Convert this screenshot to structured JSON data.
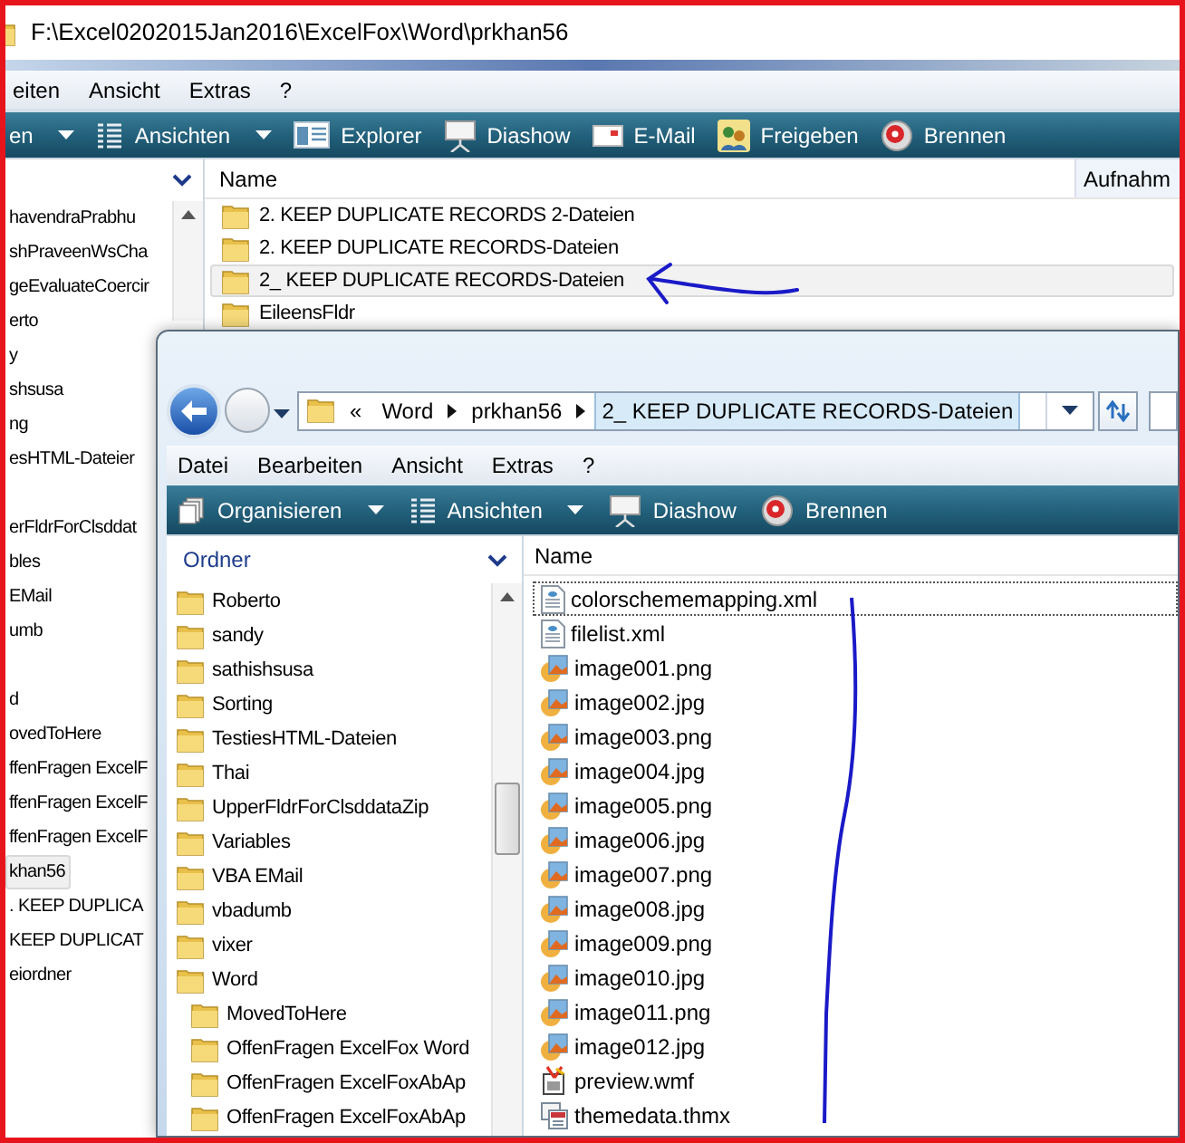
{
  "back_window": {
    "title": "F:\\Excel0202015Jan2016\\ExcelFox\\Word\\prkhan56",
    "menu": [
      "eiten",
      "Ansicht",
      "Extras",
      "?"
    ],
    "toolbar": [
      {
        "label": "en",
        "kind": "plain",
        "has_menu": true
      },
      {
        "label": "Ansichten",
        "kind": "views",
        "has_menu": true
      },
      {
        "label": "Explorer",
        "kind": "explorer",
        "has_menu": false
      },
      {
        "label": "Diashow",
        "kind": "slideshow",
        "has_menu": false
      },
      {
        "label": "E-Mail",
        "kind": "email",
        "has_menu": false
      },
      {
        "label": "Freigeben",
        "kind": "share",
        "has_menu": false
      },
      {
        "label": "Brennen",
        "kind": "burn",
        "has_menu": false
      }
    ],
    "folder_tree": [
      {
        "kind": "folder",
        "label": "havendraPrabhu",
        "selected": false
      },
      {
        "kind": "folder",
        "label": "shPraveenWsCha",
        "selected": false
      },
      {
        "kind": "folder",
        "label": "geEvaluateCoercir",
        "selected": false
      },
      {
        "kind": "folder",
        "label": "erto",
        "selected": false
      },
      {
        "kind": "folder",
        "label": "y",
        "selected": false
      },
      {
        "kind": "folder",
        "label": "shsusa",
        "selected": false
      },
      {
        "kind": "folder",
        "label": "ng",
        "selected": false
      },
      {
        "kind": "folder",
        "label": "esHTML-Dateier",
        "selected": false
      },
      {
        "kind": "blank"
      },
      {
        "kind": "folder",
        "label": "erFldrForClsddat",
        "selected": false
      },
      {
        "kind": "folder",
        "label": "bles",
        "selected": false
      },
      {
        "kind": "folder",
        "label": "EMail",
        "selected": false
      },
      {
        "kind": "folder",
        "label": "umb",
        "selected": false
      },
      {
        "kind": "blank"
      },
      {
        "kind": "folder",
        "label": "d",
        "selected": false
      },
      {
        "kind": "folder",
        "label": "ovedToHere",
        "selected": false
      },
      {
        "kind": "folder",
        "label": "ffenFragen ExcelF",
        "selected": false
      },
      {
        "kind": "folder",
        "label": "ffenFragen ExcelF",
        "selected": false
      },
      {
        "kind": "folder",
        "label": "ffenFragen ExcelF",
        "selected": false
      },
      {
        "kind": "folder",
        "label": "khan56",
        "selected": true
      },
      {
        "kind": "folder",
        "label": ". KEEP DUPLICA",
        "selected": false
      },
      {
        "kind": "folder",
        "label": "KEEP DUPLICAT",
        "selected": false
      },
      {
        "kind": "folder",
        "label": "eiordner",
        "selected": false
      }
    ],
    "file_list": {
      "columns": [
        "Name",
        "Aufnahm"
      ],
      "rows": [
        {
          "name": "2. KEEP DUPLICATE RECORDS 2-Dateien",
          "selected": false
        },
        {
          "name": "2. KEEP DUPLICATE RECORDS-Dateien",
          "selected": false
        },
        {
          "name": "2_ KEEP DUPLICATE RECORDS-Dateien",
          "selected": true
        },
        {
          "name": "EileensFldr",
          "selected": false
        }
      ]
    }
  },
  "front_window": {
    "address": {
      "overflow_mark": "«",
      "crumbs": [
        {
          "label": "Word",
          "selected": false
        },
        {
          "label": "prkhan56",
          "selected": false
        },
        {
          "label": "2_ KEEP DUPLICATE RECORDS-Dateien",
          "selected": true
        }
      ]
    },
    "menu": [
      "Datei",
      "Bearbeiten",
      "Ansicht",
      "Extras",
      "?"
    ],
    "toolbar": [
      {
        "label": "Organisieren",
        "kind": "organize",
        "has_menu": true
      },
      {
        "label": "Ansichten",
        "kind": "views",
        "has_menu": true
      },
      {
        "label": "Diashow",
        "kind": "slideshow",
        "has_menu": false
      },
      {
        "label": "Brennen",
        "kind": "burn",
        "has_menu": false
      }
    ],
    "folder_pane": {
      "title": "Ordner",
      "tree": [
        {
          "label": "Roberto",
          "selected": false
        },
        {
          "label": "sandy",
          "selected": false
        },
        {
          "label": "sathishsusa",
          "selected": false
        },
        {
          "label": "Sorting",
          "selected": false
        },
        {
          "label": "TestiesHTML-Dateien",
          "selected": false
        },
        {
          "label": "Thai",
          "selected": false
        },
        {
          "label": "UpperFldrForClsddataZip",
          "selected": false
        },
        {
          "label": "Variables",
          "selected": false
        },
        {
          "label": "VBA EMail",
          "selected": false
        },
        {
          "label": "vbadumb",
          "selected": false
        },
        {
          "label": "vixer",
          "selected": false
        },
        {
          "label": "Word",
          "selected": false,
          "children": [
            {
              "label": "MovedToHere",
              "selected": false
            },
            {
              "label": "OffenFragen ExcelFox Word",
              "selected": false
            },
            {
              "label": "OffenFragen ExcelFoxAbAp",
              "selected": false
            },
            {
              "label": "OffenFragen ExcelFoxAbAp",
              "selected": false
            }
          ]
        }
      ]
    },
    "file_list": {
      "columns": [
        "Name"
      ],
      "rows": [
        {
          "name": "colorschememapping.xml",
          "kind": "xml",
          "selected": true
        },
        {
          "name": "filelist.xml",
          "kind": "xml",
          "selected": false
        },
        {
          "name": "image001.png",
          "kind": "image",
          "selected": false
        },
        {
          "name": "image002.jpg",
          "kind": "image",
          "selected": false
        },
        {
          "name": "image003.png",
          "kind": "image",
          "selected": false
        },
        {
          "name": "image004.jpg",
          "kind": "image",
          "selected": false
        },
        {
          "name": "image005.png",
          "kind": "image",
          "selected": false
        },
        {
          "name": "image006.jpg",
          "kind": "image",
          "selected": false
        },
        {
          "name": "image007.png",
          "kind": "image",
          "selected": false
        },
        {
          "name": "image008.jpg",
          "kind": "image",
          "selected": false
        },
        {
          "name": "image009.png",
          "kind": "image",
          "selected": false
        },
        {
          "name": "image010.jpg",
          "kind": "image",
          "selected": false
        },
        {
          "name": "image011.png",
          "kind": "image",
          "selected": false
        },
        {
          "name": "image012.jpg",
          "kind": "image",
          "selected": false
        },
        {
          "name": "preview.wmf",
          "kind": "wmf",
          "selected": false
        },
        {
          "name": "themedata.thmx",
          "kind": "theme",
          "selected": false
        }
      ]
    }
  }
}
